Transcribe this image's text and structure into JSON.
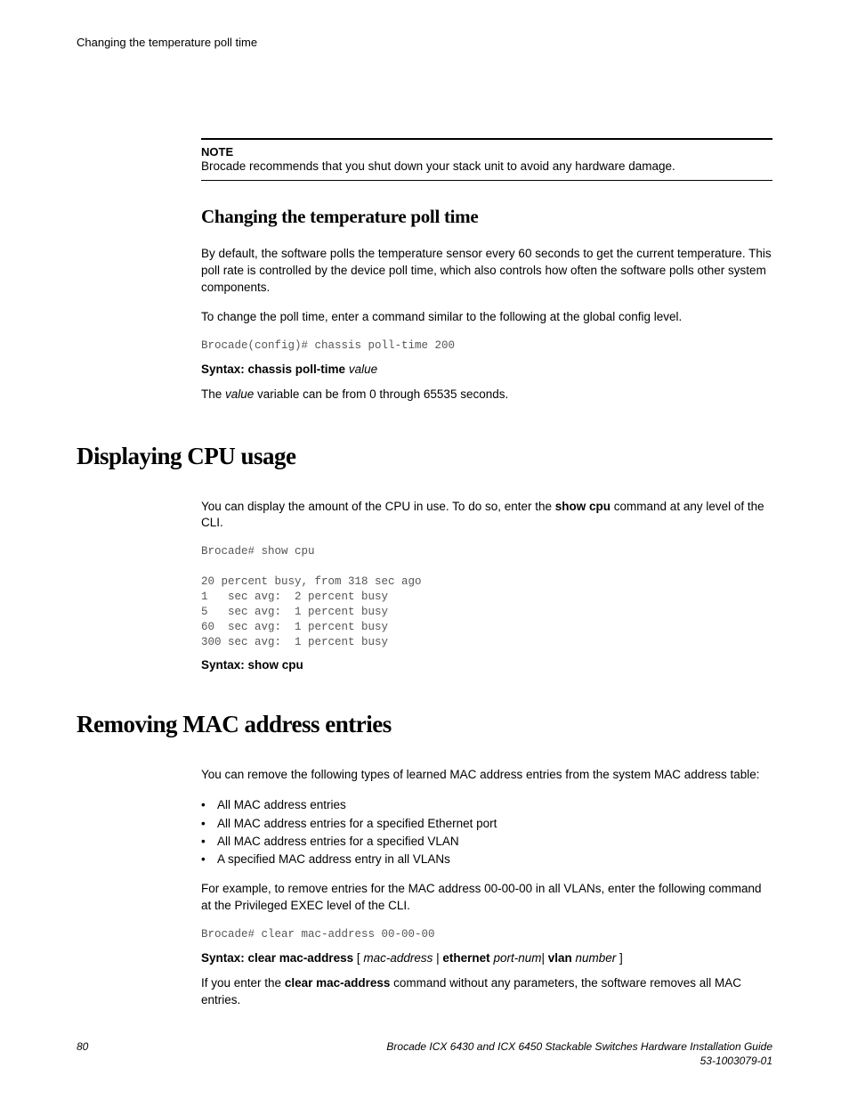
{
  "header": {
    "running_title": "Changing the temperature poll time"
  },
  "note": {
    "label": "NOTE",
    "text": "Brocade recommends that you shut down your stack unit to avoid any hardware damage."
  },
  "section1": {
    "heading": "Changing the temperature poll time",
    "p1": "By default, the software polls the temperature sensor every 60 seconds to get the current temperature. This poll rate is controlled by the device poll time, which also controls how often the software polls other system components.",
    "p2": "To change the poll time, enter a command similar to the following at the global config level.",
    "code": "Brocade(config)# chassis poll-time 200",
    "syntax_prefix": "Syntax: chassis poll-time ",
    "syntax_var": "value",
    "p3_a": "The ",
    "p3_b": "value",
    "p3_c": " variable can be from 0 through 65535 seconds."
  },
  "section2": {
    "heading": "Displaying CPU usage",
    "p1_a": "You can display the amount of the CPU in use. To do so, enter the ",
    "p1_b": "show cpu",
    "p1_c": " command at any level of the CLI.",
    "code": "Brocade# show cpu\n\n20 percent busy, from 318 sec ago\n1   sec avg:  2 percent busy\n5   sec avg:  1 percent busy\n60  sec avg:  1 percent busy\n300 sec avg:  1 percent busy",
    "syntax": "Syntax: show cpu"
  },
  "section3": {
    "heading": "Removing MAC address entries",
    "p1": "You can remove the following types of learned MAC address entries from the system MAC address table:",
    "bullets": [
      "All MAC address entries",
      "All MAC address entries for a specified Ethernet port",
      "All MAC address entries for a specified VLAN",
      "A specified MAC address entry in all VLANs"
    ],
    "p2": "For example, to remove entries for the MAC address 00-00-00 in all VLANs, enter the following command at the Privileged EXEC level of the CLI.",
    "code": "Brocade# clear mac-address 00-00-00",
    "syntax_a": "Syntax: clear mac-address",
    "syntax_b": " [ ",
    "syntax_c": "mac-address",
    "syntax_d": " | ",
    "syntax_e": "ethernet",
    "syntax_f": " ",
    "syntax_g": "port-num",
    "syntax_h": "| ",
    "syntax_i": "vlan",
    "syntax_j": " ",
    "syntax_k": "number",
    "syntax_l": " ]",
    "p3_a": "If you enter the ",
    "p3_b": "clear mac-address",
    "p3_c": " command without any parameters, the software removes all MAC entries."
  },
  "footer": {
    "page_number": "80",
    "guide_title": "Brocade ICX 6430 and ICX 6450 Stackable Switches Hardware Installation Guide",
    "doc_number": "53-1003079-01"
  }
}
